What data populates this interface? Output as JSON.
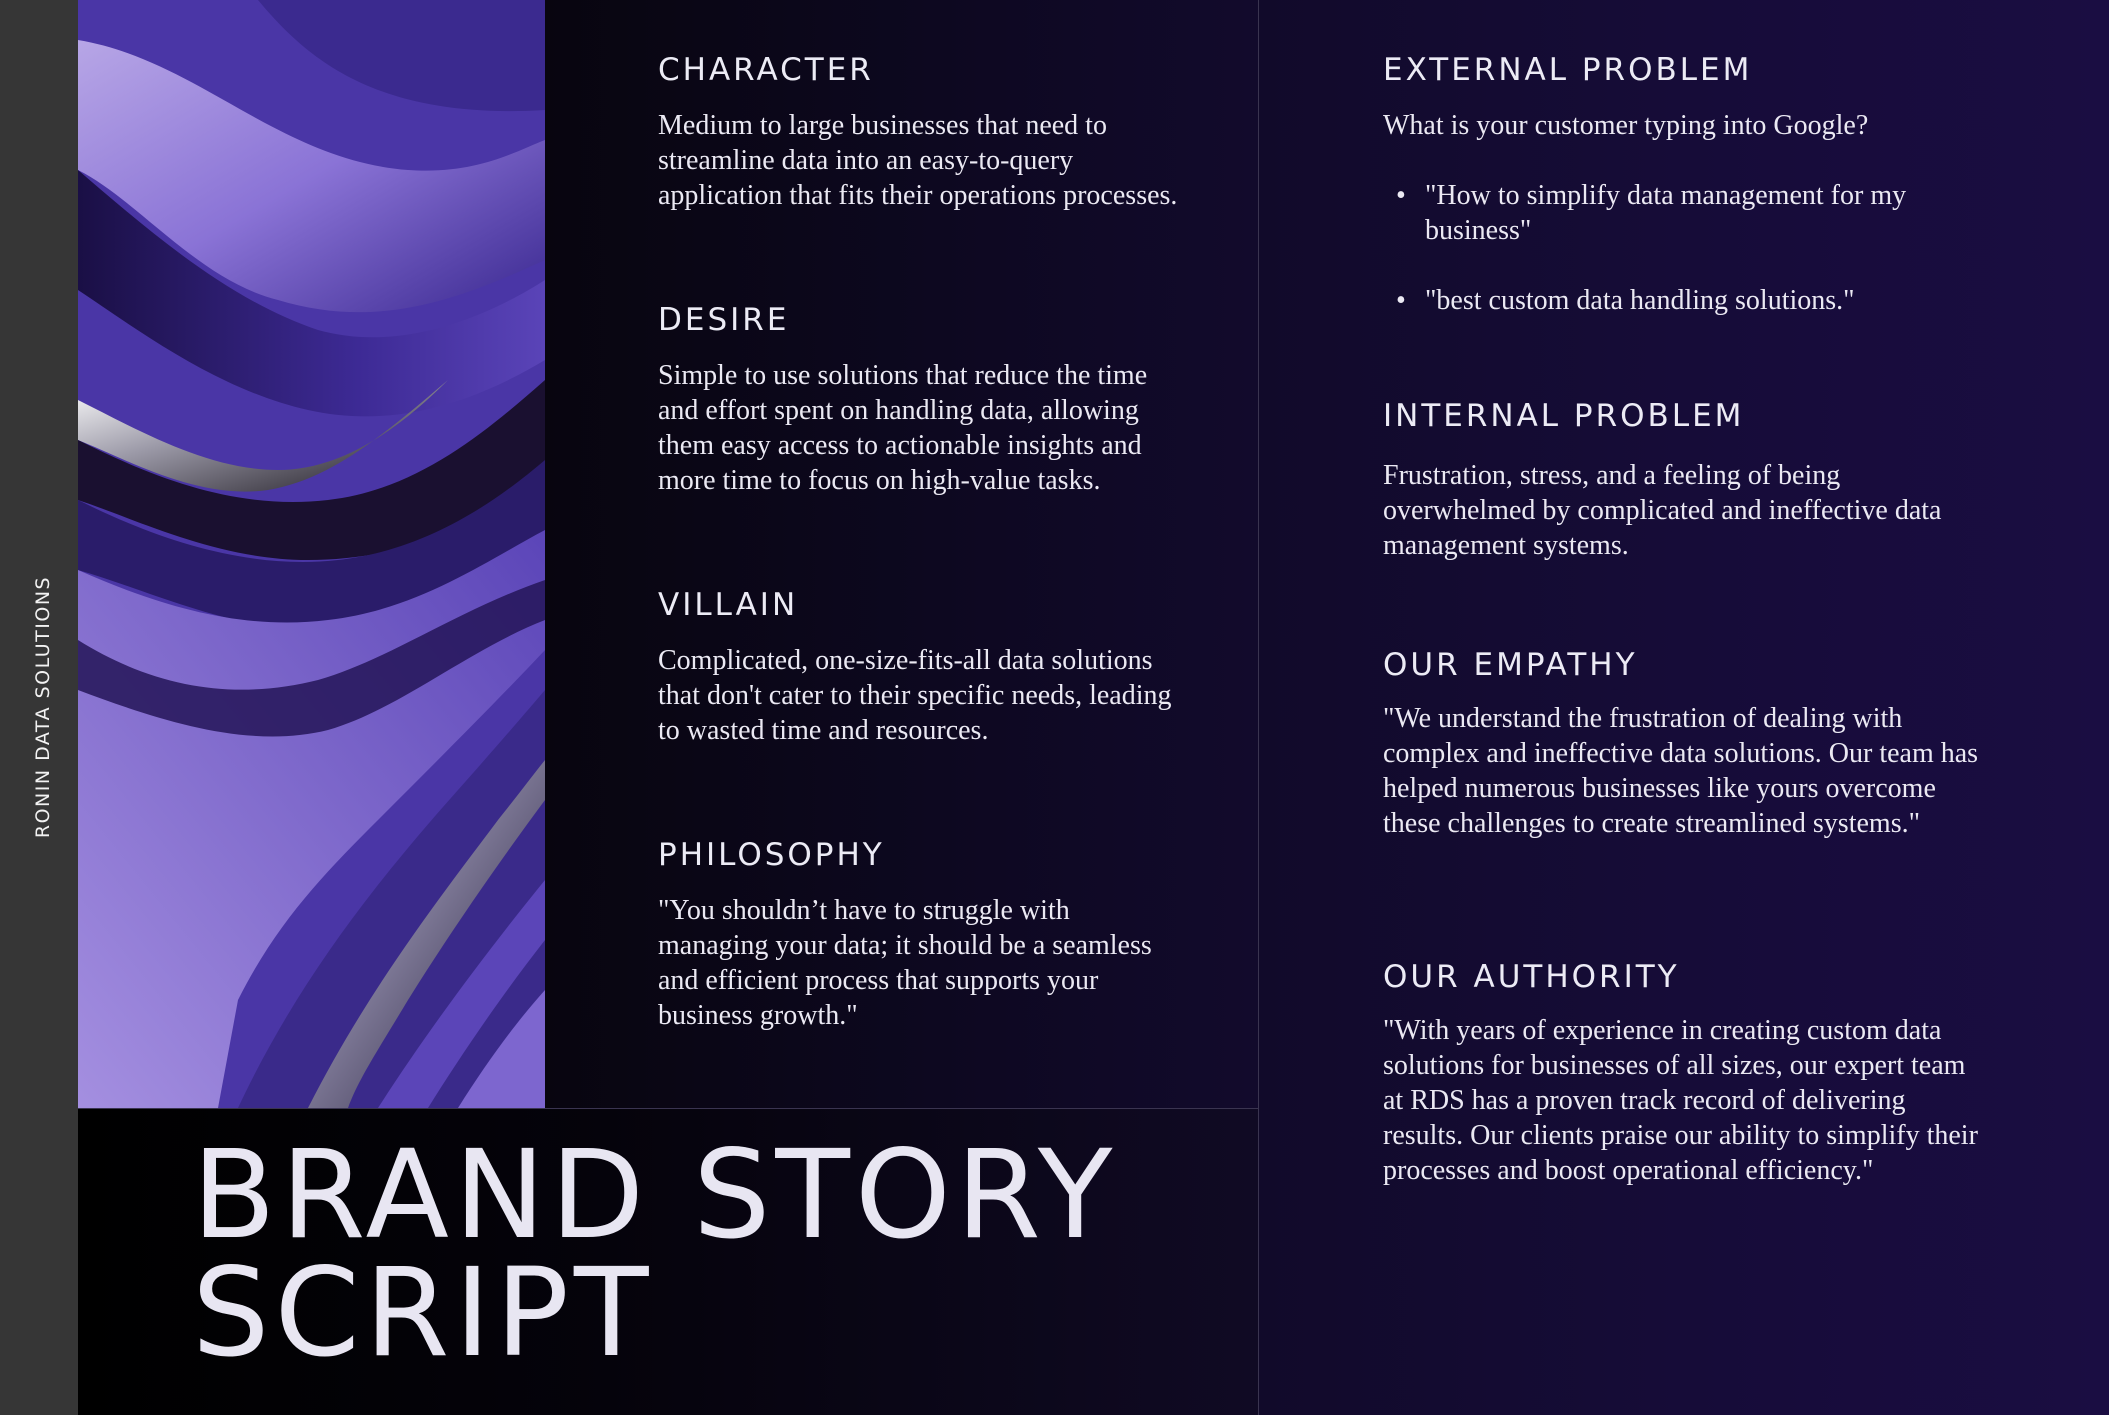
{
  "sidebar": {
    "company_name": "RONIN DATA SOLUTIONS"
  },
  "title": {
    "line1": "BRAND STORY",
    "line2": "SCRIPT"
  },
  "colors": {
    "background": "#0b0616",
    "sidebar": "#363636",
    "accent_purple": "#6b55c4",
    "text": "#ebe9f3"
  },
  "sections": {
    "character": {
      "heading": "CHARACTER",
      "body": "Medium to large businesses that need to streamline data into an easy-to-query application that fits their operations processes."
    },
    "desire": {
      "heading": "DESIRE",
      "body": "Simple to use solutions that reduce the time and effort spent on handling data, allowing them easy access to actionable insights and more time to focus on high-value tasks."
    },
    "villain": {
      "heading": "VILLAIN",
      "body": "Complicated, one-size-fits-all data solutions that don't cater to their specific needs, leading to wasted time and resources."
    },
    "philosophy": {
      "heading": "PHILOSOPHY",
      "body": "\"You shouldn’t have to struggle with managing your data; it should be a seamless and efficient process that supports your business growth.\""
    },
    "external_problem": {
      "heading": "EXTERNAL PROBLEM",
      "intro": "What is your customer typing into Google?",
      "bullets": [
        "\"How to simplify data management for my business\"",
        "\"best custom data handling solutions.\""
      ]
    },
    "internal_problem": {
      "heading": "INTERNAL PROBLEM",
      "body": "Frustration, stress, and a feeling of being overwhelmed by complicated and ineffective data management systems."
    },
    "our_empathy": {
      "heading": "OUR EMPATHY",
      "body": "\"We understand the frustration of dealing with complex and ineffective data solutions. Our team has helped numerous businesses like yours overcome these challenges to create streamlined systems.\""
    },
    "our_authority": {
      "heading": "OUR AUTHORITY",
      "body": "\"With years of experience in creating custom data solutions for businesses of all sizes, our expert team at RDS has a proven track record of delivering results. Our clients praise our ability to simplify their processes and boost operational efficiency.\""
    }
  }
}
